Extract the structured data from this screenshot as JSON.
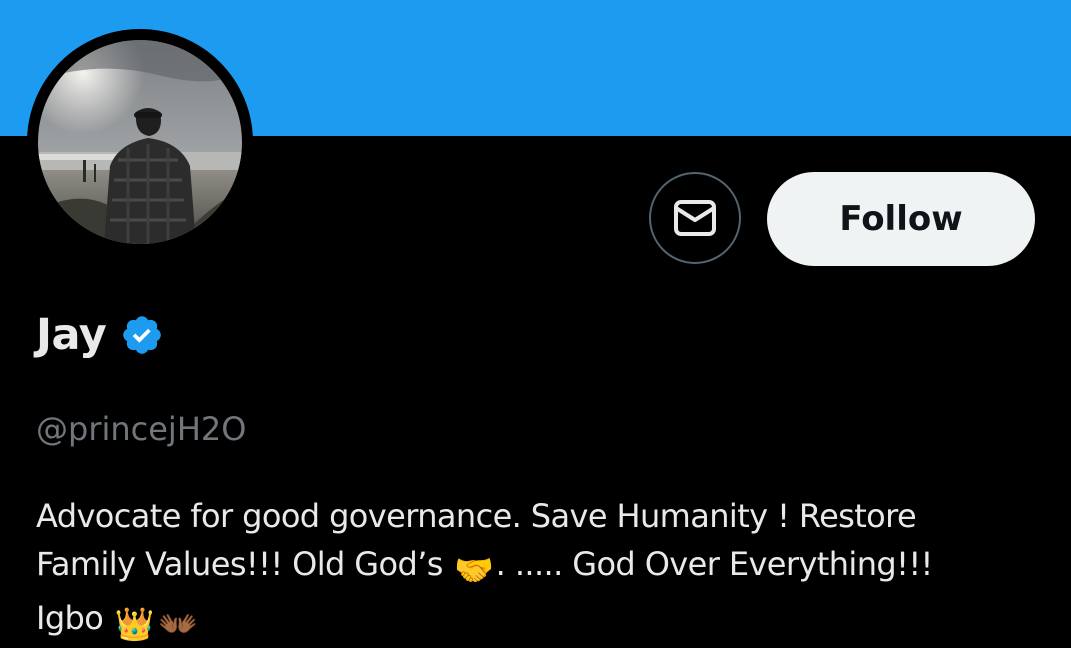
{
  "colors": {
    "banner": "#1d9bf0",
    "background": "#000000",
    "verified": "#1d9bf0",
    "primary_text": "#e7e9ea",
    "secondary_text": "#71767b",
    "follow_bg": "#eff3f4"
  },
  "profile": {
    "avatar_icon": "profile-photo",
    "display_name": "Jay",
    "verified_icon": "verified-badge-icon",
    "handle": "@princejH2O",
    "bio": {
      "line1": "Advocate for good governance. Save Humanity ! Restore",
      "line2_a": "Family Values!!! Old God’s ",
      "line2_emoji": "🤝",
      "line2_b": ". ..... God Over Everything!!!",
      "line3_a": "Igbo ",
      "line3_emoji_1": "👑",
      "line3_emoji_2": "👐🏾"
    }
  },
  "actions": {
    "message_icon": "envelope-icon",
    "follow_label": "Follow"
  }
}
